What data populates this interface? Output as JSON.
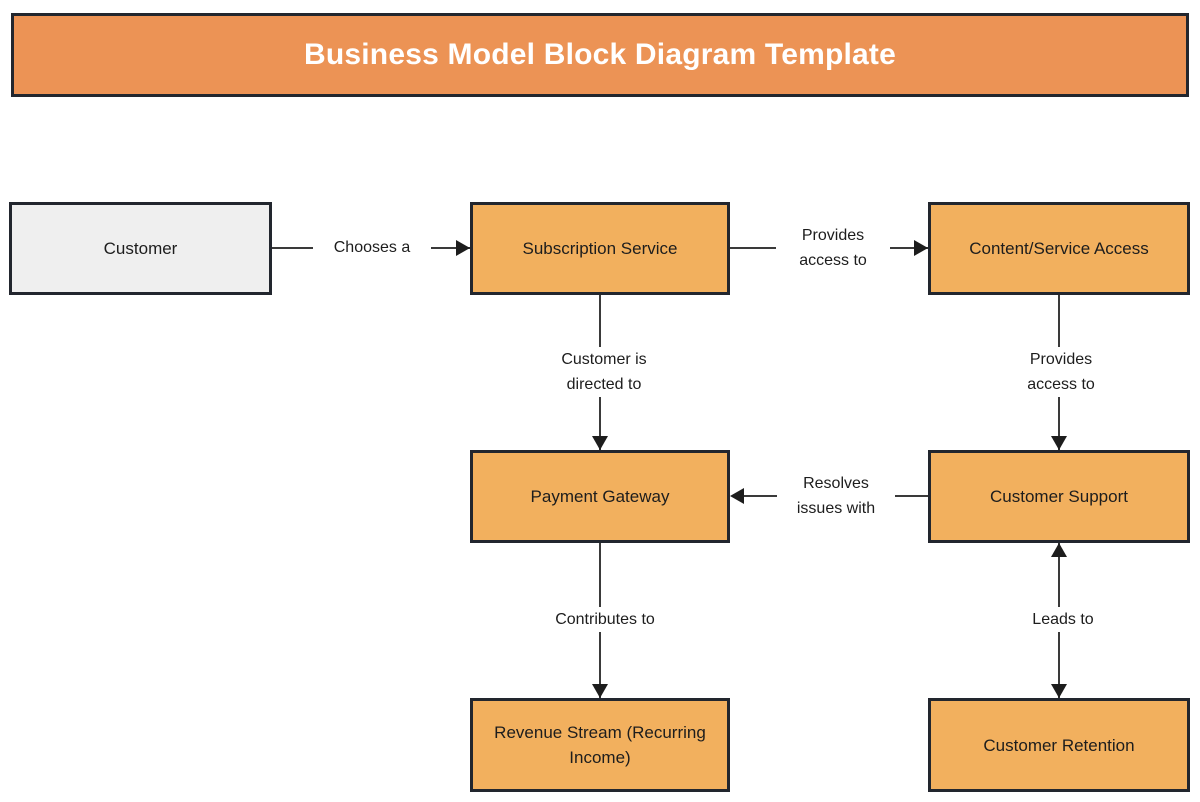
{
  "header": {
    "title": "Business Model Block Diagram Template",
    "background_color": "#ec9355",
    "border_color": "#22262e",
    "text_color": "#ffffff"
  },
  "theme": {
    "block_fill_orange": "#f2b05e",
    "block_fill_grey": "#efefef",
    "block_border": "#22262e",
    "connector_color": "#3a3a3a",
    "arrow_color": "#1d1d1d",
    "canvas_background": "#ffffff"
  },
  "diagram": {
    "type": "block-diagram",
    "nodes": [
      {
        "id": "customer",
        "label": "Customer",
        "style": "grey"
      },
      {
        "id": "subscription",
        "label": "Subscription Service",
        "style": "orange"
      },
      {
        "id": "content",
        "label": "Content/Service\nAccess",
        "style": "orange"
      },
      {
        "id": "payment",
        "label": "Payment Gateway",
        "style": "orange"
      },
      {
        "id": "support",
        "label": "Customer Support",
        "style": "orange"
      },
      {
        "id": "revenue",
        "label": "Revenue Stream\n(Recurring Income)",
        "style": "orange"
      },
      {
        "id": "retention",
        "label": "Customer Retention",
        "style": "orange"
      }
    ],
    "edges": [
      {
        "id": "e1",
        "from": "customer",
        "to": "subscription",
        "label": "Chooses a",
        "direction": "right"
      },
      {
        "id": "e2",
        "from": "subscription",
        "to": "content",
        "label": "Provides\naccess to",
        "direction": "right"
      },
      {
        "id": "e3",
        "from": "subscription",
        "to": "payment",
        "label": "Customer is\ndirected to",
        "direction": "down"
      },
      {
        "id": "e4",
        "from": "content",
        "to": "support",
        "label": "Provides\naccess to",
        "direction": "down"
      },
      {
        "id": "e5",
        "from": "support",
        "to": "payment",
        "label": "Resolves\nissues with",
        "direction": "left"
      },
      {
        "id": "e6",
        "from": "payment",
        "to": "revenue",
        "label": "Contributes to",
        "direction": "down"
      },
      {
        "id": "e7",
        "from": "retention",
        "to": "support",
        "label": "Leads to",
        "direction": "both"
      }
    ]
  }
}
